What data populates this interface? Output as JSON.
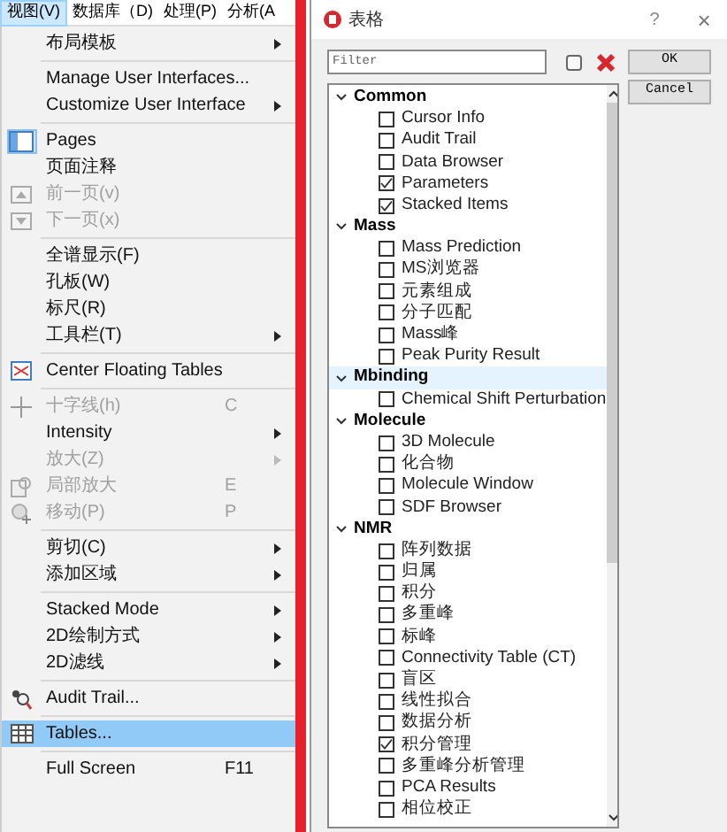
{
  "menubar": [
    {
      "label": "视图(V)",
      "selected": true
    },
    {
      "label": "数据库（D)",
      "selected": false
    },
    {
      "label": "处理(P)",
      "selected": false
    },
    {
      "label": "分析(A",
      "selected": false
    }
  ],
  "menu": {
    "items": [
      {
        "kind": "item",
        "label": "布局模板",
        "submenu": true,
        "disabled": false,
        "selected": false
      },
      {
        "kind": "separator"
      },
      {
        "kind": "item",
        "label": "Manage User Interfaces...",
        "disabled": false,
        "selected": false
      },
      {
        "kind": "item",
        "label": "Customize User Interface",
        "submenu": true,
        "disabled": false,
        "selected": false
      },
      {
        "kind": "separator"
      },
      {
        "kind": "item",
        "label": "Pages",
        "disabled": false,
        "selected": false,
        "checked": true
      },
      {
        "kind": "item",
        "label": "页面注释",
        "disabled": false,
        "selected": false
      },
      {
        "kind": "item",
        "label": "前一页(v)",
        "disabled": true,
        "selected": false
      },
      {
        "kind": "item",
        "label": "下一页(x)",
        "disabled": true,
        "selected": false
      },
      {
        "kind": "separator"
      },
      {
        "kind": "item",
        "label": "全谱显示(F)",
        "disabled": false,
        "selected": false
      },
      {
        "kind": "item",
        "label": "孔板(W)",
        "disabled": false,
        "selected": false
      },
      {
        "kind": "item",
        "label": "标尺(R)",
        "disabled": false,
        "selected": false
      },
      {
        "kind": "item",
        "label": "工具栏(T)",
        "submenu": true,
        "disabled": false,
        "selected": false
      },
      {
        "kind": "separator"
      },
      {
        "kind": "item",
        "label": "Center Floating Tables",
        "disabled": false,
        "selected": false
      },
      {
        "kind": "separator"
      },
      {
        "kind": "item",
        "label": "十字线(h)",
        "shortcut": "C",
        "disabled": true,
        "selected": false
      },
      {
        "kind": "item",
        "label": "Intensity",
        "submenu": true,
        "disabled": false,
        "selected": false
      },
      {
        "kind": "item",
        "label": "放大(Z)",
        "submenu": true,
        "disabled": true,
        "selected": false
      },
      {
        "kind": "item",
        "label": "局部放大",
        "shortcut": "E",
        "disabled": true,
        "selected": false
      },
      {
        "kind": "item",
        "label": "移动(P)",
        "shortcut": "P",
        "disabled": true,
        "selected": false
      },
      {
        "kind": "separator"
      },
      {
        "kind": "item",
        "label": "剪切(C)",
        "submenu": true,
        "disabled": false,
        "selected": false
      },
      {
        "kind": "item",
        "label": "添加区域",
        "submenu": true,
        "disabled": false,
        "selected": false
      },
      {
        "kind": "separator"
      },
      {
        "kind": "item",
        "label": "Stacked Mode",
        "submenu": true,
        "disabled": false,
        "selected": false
      },
      {
        "kind": "item",
        "label": "2D绘制方式",
        "submenu": true,
        "disabled": false,
        "selected": false
      },
      {
        "kind": "item",
        "label": "2D滤线",
        "submenu": true,
        "disabled": false,
        "selected": false
      },
      {
        "kind": "separator"
      },
      {
        "kind": "item",
        "label": "Audit Trail...",
        "disabled": false,
        "selected": false
      },
      {
        "kind": "separator"
      },
      {
        "kind": "item",
        "label": "Tables...",
        "disabled": false,
        "selected": true
      },
      {
        "kind": "separator"
      },
      {
        "kind": "item",
        "label": "Full Screen",
        "shortcut": "F11",
        "disabled": false,
        "selected": false
      }
    ]
  },
  "dialog": {
    "title": "表格",
    "help": "?",
    "close": "×",
    "filter": {
      "placeholder": "Filter"
    },
    "buttons": [
      "OK",
      "Cancel"
    ],
    "tree": [
      {
        "label": "Common",
        "expanded": true,
        "selected": false,
        "children": [
          {
            "label": "Cursor Info",
            "checked": false
          },
          {
            "label": "Audit Trail",
            "checked": false
          },
          {
            "label": "Data Browser",
            "checked": false
          },
          {
            "label": "Parameters",
            "checked": true
          },
          {
            "label": "Stacked Items",
            "checked": true
          }
        ]
      },
      {
        "label": "Mass",
        "expanded": true,
        "selected": false,
        "children": [
          {
            "label": "Mass Prediction",
            "checked": false
          },
          {
            "label": "MS浏览器",
            "checked": false
          },
          {
            "label": "元素组成",
            "checked": false
          },
          {
            "label": "分子匹配",
            "checked": false
          },
          {
            "label": "Mass峰",
            "checked": false
          },
          {
            "label": "Peak Purity Result",
            "checked": false
          }
        ]
      },
      {
        "label": "Mbinding",
        "expanded": true,
        "selected": true,
        "children": [
          {
            "label": "Chemical Shift Perturbation",
            "checked": false
          }
        ]
      },
      {
        "label": "Molecule",
        "expanded": true,
        "selected": false,
        "children": [
          {
            "label": "3D Molecule",
            "checked": false
          },
          {
            "label": "化合物",
            "checked": false
          },
          {
            "label": "Molecule Window",
            "checked": false
          },
          {
            "label": "SDF Browser",
            "checked": false
          }
        ]
      },
      {
        "label": "NMR",
        "expanded": true,
        "selected": false,
        "children": [
          {
            "label": "阵列数据",
            "checked": false
          },
          {
            "label": "归属",
            "checked": false
          },
          {
            "label": "积分",
            "checked": false
          },
          {
            "label": "多重峰",
            "checked": false
          },
          {
            "label": "标峰",
            "checked": false
          },
          {
            "label": "Connectivity Table (CT)",
            "checked": false
          },
          {
            "label": "盲区",
            "checked": false
          },
          {
            "label": "线性拟合",
            "checked": false
          },
          {
            "label": "数据分析",
            "checked": false
          },
          {
            "label": "积分管理",
            "checked": true
          },
          {
            "label": "多重峰分析管理",
            "checked": false
          },
          {
            "label": "PCA Results",
            "checked": false
          },
          {
            "label": "相位校正",
            "checked": false
          }
        ]
      }
    ]
  }
}
